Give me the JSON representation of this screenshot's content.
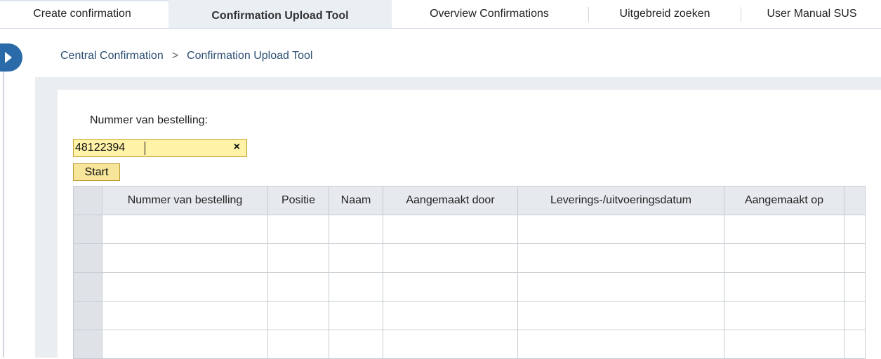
{
  "tabs": [
    {
      "label": "Create confirmation",
      "active": false
    },
    {
      "label": "Confirmation Upload Tool",
      "active": true
    },
    {
      "label": "Overview Confirmations",
      "active": false
    },
    {
      "label": "Uitgebreid zoeken",
      "active": false
    },
    {
      "label": "User Manual SUS",
      "active": false
    }
  ],
  "breadcrumb": {
    "items": [
      "Central Confirmation",
      "Confirmation Upload Tool"
    ],
    "separator": ">"
  },
  "nav_toggle_icon": "chevron-right-icon",
  "form": {
    "label": "Nummer van bestelling:",
    "value": "48122394",
    "clear_icon": "×",
    "start_label": "Start"
  },
  "table": {
    "columns": [
      "Nummer van bestelling",
      "Positie",
      "Naam",
      "Aangemaakt door",
      "Leverings-/uitvoeringsdatum",
      "Aangemaakt op"
    ],
    "empty_rows": 5
  },
  "colors": {
    "accent": "#2a6aa8",
    "input_bg": "#fff3a8",
    "button_bg": "#f7e59a",
    "active_tab_bg": "#eaeff4"
  }
}
